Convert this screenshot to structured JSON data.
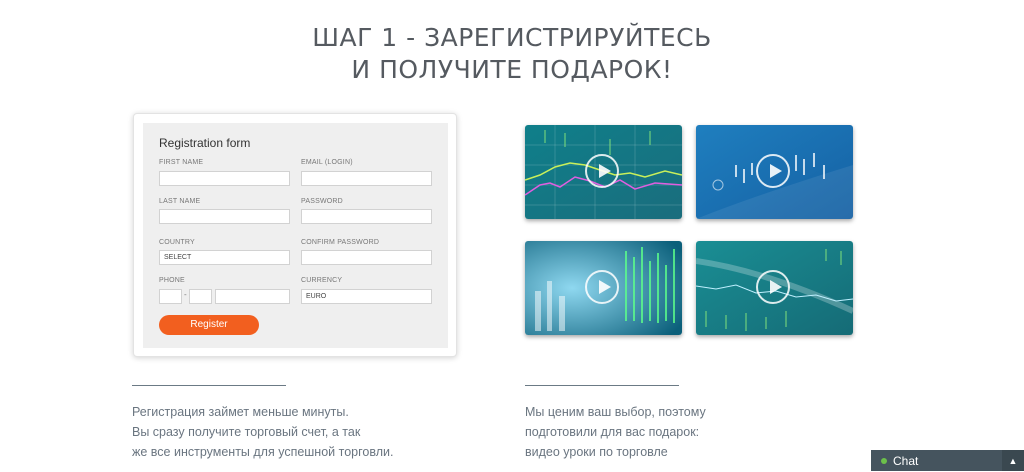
{
  "headline": {
    "line1": "ШАГ 1 - ЗАРЕГИСТРИРУЙТЕСЬ",
    "line2": "И ПОЛУЧИТЕ ПОДАРОК!"
  },
  "form": {
    "title": "Registration form",
    "first_name_label": "FIRST NAME",
    "email_label": "EMAIL (LOGIN)",
    "last_name_label": "LAST NAME",
    "password_label": "PASSWORD",
    "country_label": "COUNTRY",
    "country_value": "SELECT",
    "confirm_password_label": "CONFIRM PASSWORD",
    "phone_label": "PHONE",
    "phone_separator": "-",
    "currency_label": "CURRENCY",
    "currency_value": "EURO",
    "submit_label": "Register"
  },
  "left_text": {
    "line1": "Регистрация займет меньше минуты.",
    "line2": "Вы сразу получите торговый счет, а так",
    "line3": "же все инструменты для успешной торговли."
  },
  "right_text": {
    "line1": "Мы ценим ваш выбор, поэтому",
    "line2": "подготовили для вас подарок:",
    "line3": "видео уроки по торговле"
  },
  "videos": [
    {
      "icon": "play-icon"
    },
    {
      "icon": "play-icon"
    },
    {
      "icon": "play-icon"
    },
    {
      "icon": "play-icon"
    }
  ],
  "chat": {
    "label": "Chat",
    "toggle_icon": "collapse-icon"
  },
  "colors": {
    "accent": "#f25f1f",
    "chat_bg": "#45545e",
    "online": "#6cc04a",
    "thumb_teal": "#1d8e95"
  }
}
